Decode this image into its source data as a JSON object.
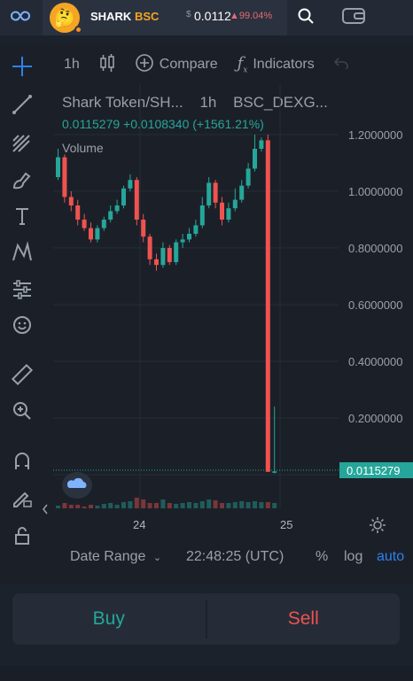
{
  "header": {
    "token_symbol": "SHARK",
    "token_chain": "BSC",
    "currency_symbol": "$",
    "price": "0.0112",
    "change": "▲99.04%",
    "avatar_emoji": "🤔"
  },
  "toolbar": {
    "interval": "1h",
    "compare_label": "Compare",
    "indicators_label": "Indicators"
  },
  "chart_header": {
    "pair": "Shark Token/SH...",
    "interval": "1h",
    "exchange": "BSC_DEXG...",
    "ohlc": "0.0115279  +0.0108340 (+1561.21%)",
    "volume_label": "Volume"
  },
  "chart_data": {
    "type": "candlestick",
    "ylim": [
      0,
      1.3
    ],
    "x_ticks": [
      "24",
      "25"
    ],
    "y_ticks": [
      "1.2000000",
      "1.0000000",
      "0.8000000",
      "0.6000000",
      "0.4000000",
      "0.2000000"
    ],
    "last_price": "0.0115279",
    "candles": [
      {
        "o": 1.05,
        "h": 1.15,
        "l": 1.04,
        "c": 1.12
      },
      {
        "o": 1.12,
        "h": 1.13,
        "l": 0.96,
        "c": 0.98
      },
      {
        "o": 0.98,
        "h": 1.0,
        "l": 0.93,
        "c": 0.95
      },
      {
        "o": 0.95,
        "h": 0.97,
        "l": 0.88,
        "c": 0.9
      },
      {
        "o": 0.9,
        "h": 0.92,
        "l": 0.86,
        "c": 0.87
      },
      {
        "o": 0.87,
        "h": 0.89,
        "l": 0.82,
        "c": 0.83
      },
      {
        "o": 0.83,
        "h": 0.88,
        "l": 0.82,
        "c": 0.87
      },
      {
        "o": 0.87,
        "h": 0.91,
        "l": 0.86,
        "c": 0.9
      },
      {
        "o": 0.9,
        "h": 0.95,
        "l": 0.89,
        "c": 0.93
      },
      {
        "o": 0.93,
        "h": 0.97,
        "l": 0.92,
        "c": 0.95
      },
      {
        "o": 0.95,
        "h": 1.02,
        "l": 0.94,
        "c": 1.01
      },
      {
        "o": 1.01,
        "h": 1.06,
        "l": 1.0,
        "c": 1.04
      },
      {
        "o": 1.04,
        "h": 1.05,
        "l": 0.88,
        "c": 0.9
      },
      {
        "o": 0.9,
        "h": 0.92,
        "l": 0.82,
        "c": 0.84
      },
      {
        "o": 0.84,
        "h": 0.85,
        "l": 0.74,
        "c": 0.76
      },
      {
        "o": 0.76,
        "h": 0.78,
        "l": 0.72,
        "c": 0.74
      },
      {
        "o": 0.74,
        "h": 0.82,
        "l": 0.73,
        "c": 0.8
      },
      {
        "o": 0.8,
        "h": 0.81,
        "l": 0.74,
        "c": 0.75
      },
      {
        "o": 0.75,
        "h": 0.83,
        "l": 0.74,
        "c": 0.82
      },
      {
        "o": 0.82,
        "h": 0.85,
        "l": 0.8,
        "c": 0.83
      },
      {
        "o": 0.83,
        "h": 0.87,
        "l": 0.82,
        "c": 0.85
      },
      {
        "o": 0.85,
        "h": 0.9,
        "l": 0.84,
        "c": 0.88
      },
      {
        "o": 0.88,
        "h": 0.98,
        "l": 0.87,
        "c": 0.95
      },
      {
        "o": 0.95,
        "h": 1.05,
        "l": 0.94,
        "c": 1.03
      },
      {
        "o": 1.03,
        "h": 1.04,
        "l": 0.94,
        "c": 0.96
      },
      {
        "o": 0.96,
        "h": 0.98,
        "l": 0.88,
        "c": 0.9
      },
      {
        "o": 0.9,
        "h": 0.96,
        "l": 0.89,
        "c": 0.94
      },
      {
        "o": 0.94,
        "h": 1.01,
        "l": 0.93,
        "c": 0.97
      },
      {
        "o": 0.97,
        "h": 1.04,
        "l": 0.96,
        "c": 1.02
      },
      {
        "o": 1.02,
        "h": 1.1,
        "l": 1.01,
        "c": 1.08
      },
      {
        "o": 1.08,
        "h": 1.2,
        "l": 1.07,
        "c": 1.15
      },
      {
        "o": 1.15,
        "h": 1.19,
        "l": 1.14,
        "c": 1.18
      },
      {
        "o": 1.18,
        "h": 1.2,
        "l": 0.01,
        "c": 0.01
      },
      {
        "o": 0.01,
        "h": 0.24,
        "l": 0.005,
        "c": 0.0115
      }
    ],
    "volumes": [
      0.15,
      0.3,
      0.2,
      0.2,
      0.1,
      0.2,
      0.15,
      0.25,
      0.3,
      0.2,
      0.35,
      0.4,
      0.6,
      0.5,
      0.3,
      0.3,
      0.5,
      0.3,
      0.25,
      0.3,
      0.35,
      0.3,
      0.4,
      0.5,
      0.45,
      0.3,
      0.3,
      0.35,
      0.4,
      0.35,
      0.4,
      0.35,
      0.35,
      0.3
    ]
  },
  "bottom": {
    "date_range": "Date Range",
    "time": "22:48:25 (UTC)",
    "percent": "%",
    "log": "log",
    "auto": "auto"
  },
  "trade": {
    "buy_label": "Buy",
    "sell_label": "Sell"
  },
  "colors": {
    "up": "#26a69a",
    "down": "#ef5350",
    "accent": "#f5a524"
  }
}
